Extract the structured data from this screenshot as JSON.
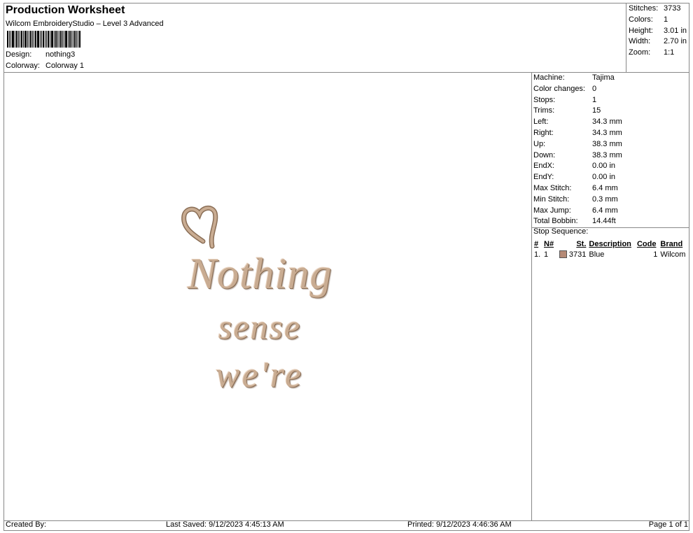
{
  "header": {
    "title": "Production Worksheet",
    "subtitle": "Wilcom EmbroideryStudio – Level 3 Advanced",
    "design_label": "Design:",
    "design_value": "nothing3",
    "colorway_label": "Colorway:",
    "colorway_value": "Colorway 1"
  },
  "stats": [
    {
      "label": "Stitches:",
      "value": "3733"
    },
    {
      "label": "Colors:",
      "value": "1"
    },
    {
      "label": "Height:",
      "value": "3.01 in"
    },
    {
      "label": "Width:",
      "value": "2.70 in"
    },
    {
      "label": "Zoom:",
      "value": "1:1"
    }
  ],
  "machine_info": [
    {
      "label": "Machine:",
      "value": "Tajima"
    },
    {
      "label": "Color changes:",
      "value": "0"
    },
    {
      "label": "Stops:",
      "value": "1"
    },
    {
      "label": "Trims:",
      "value": "15"
    },
    {
      "label": "Left:",
      "value": "34.3 mm"
    },
    {
      "label": "Right:",
      "value": "34.3 mm"
    },
    {
      "label": "Up:",
      "value": "38.3 mm"
    },
    {
      "label": "Down:",
      "value": "38.3 mm"
    },
    {
      "label": "EndX:",
      "value": "0.00 in"
    },
    {
      "label": "EndY:",
      "value": "0.00 in"
    },
    {
      "label": "Max Stitch:",
      "value": "6.4 mm"
    },
    {
      "label": "Min Stitch:",
      "value": "0.3 mm"
    },
    {
      "label": "Max Jump:",
      "value": "6.4 mm"
    },
    {
      "label": "Total Bobbin:",
      "value": "14.44ft"
    }
  ],
  "stop_sequence": {
    "title": "Stop Sequence:",
    "headers": [
      "#",
      "N#",
      "St.",
      "Description",
      "Code",
      "Brand"
    ],
    "rows": [
      {
        "num": "1.",
        "n": "1",
        "swatch_color": "#b58a76",
        "st": "3731",
        "description": "Blue",
        "code": "1",
        "brand": "Wilcom"
      }
    ]
  },
  "design": {
    "lines": [
      "Nothing",
      "sense",
      "we're"
    ],
    "thread_color": "#c9ac92"
  },
  "footer": {
    "created_by": "Created By:",
    "last_saved": "Last Saved: 9/12/2023 4:45:13 AM",
    "printed": "Printed: 9/12/2023 4:46:36 AM",
    "page": "Page 1 of 1"
  }
}
